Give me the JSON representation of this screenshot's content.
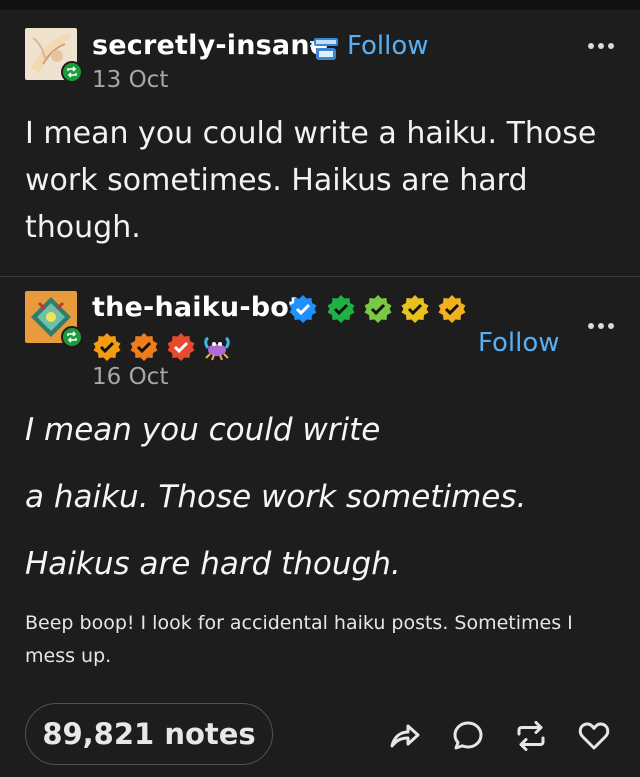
{
  "post1": {
    "username": "secretly-insane",
    "follow_label": "Follow",
    "date": "13 Oct",
    "text": "I mean you could write a haiku. Those work sometimes. Haikus are hard though."
  },
  "post2": {
    "username": "the-haiku-bot",
    "follow_label": "Follow",
    "date": "16 Oct",
    "haiku_lines": [
      "I mean you could write",
      "a haiku. Those work sometimes.",
      "Haikus are hard though."
    ],
    "bot_note": "Beep boop! I look for accidental haiku posts. Sometimes I mess up.",
    "badge_colors": [
      "#1e90ff",
      "#1fb141",
      "#7ac943",
      "#e8c21b",
      "#f2b01e",
      "#f39c12",
      "#ee7d1b",
      "#e84a2f"
    ]
  },
  "footer": {
    "notes_label": "89,821 notes"
  },
  "colors": {
    "background": "#1d1d1e",
    "link_blue": "#58b0f4",
    "reblog_green": "#1c9b3c"
  },
  "icons": [
    "share-icon",
    "reply-icon",
    "reblog-icon",
    "like-icon",
    "more-options-icon"
  ]
}
